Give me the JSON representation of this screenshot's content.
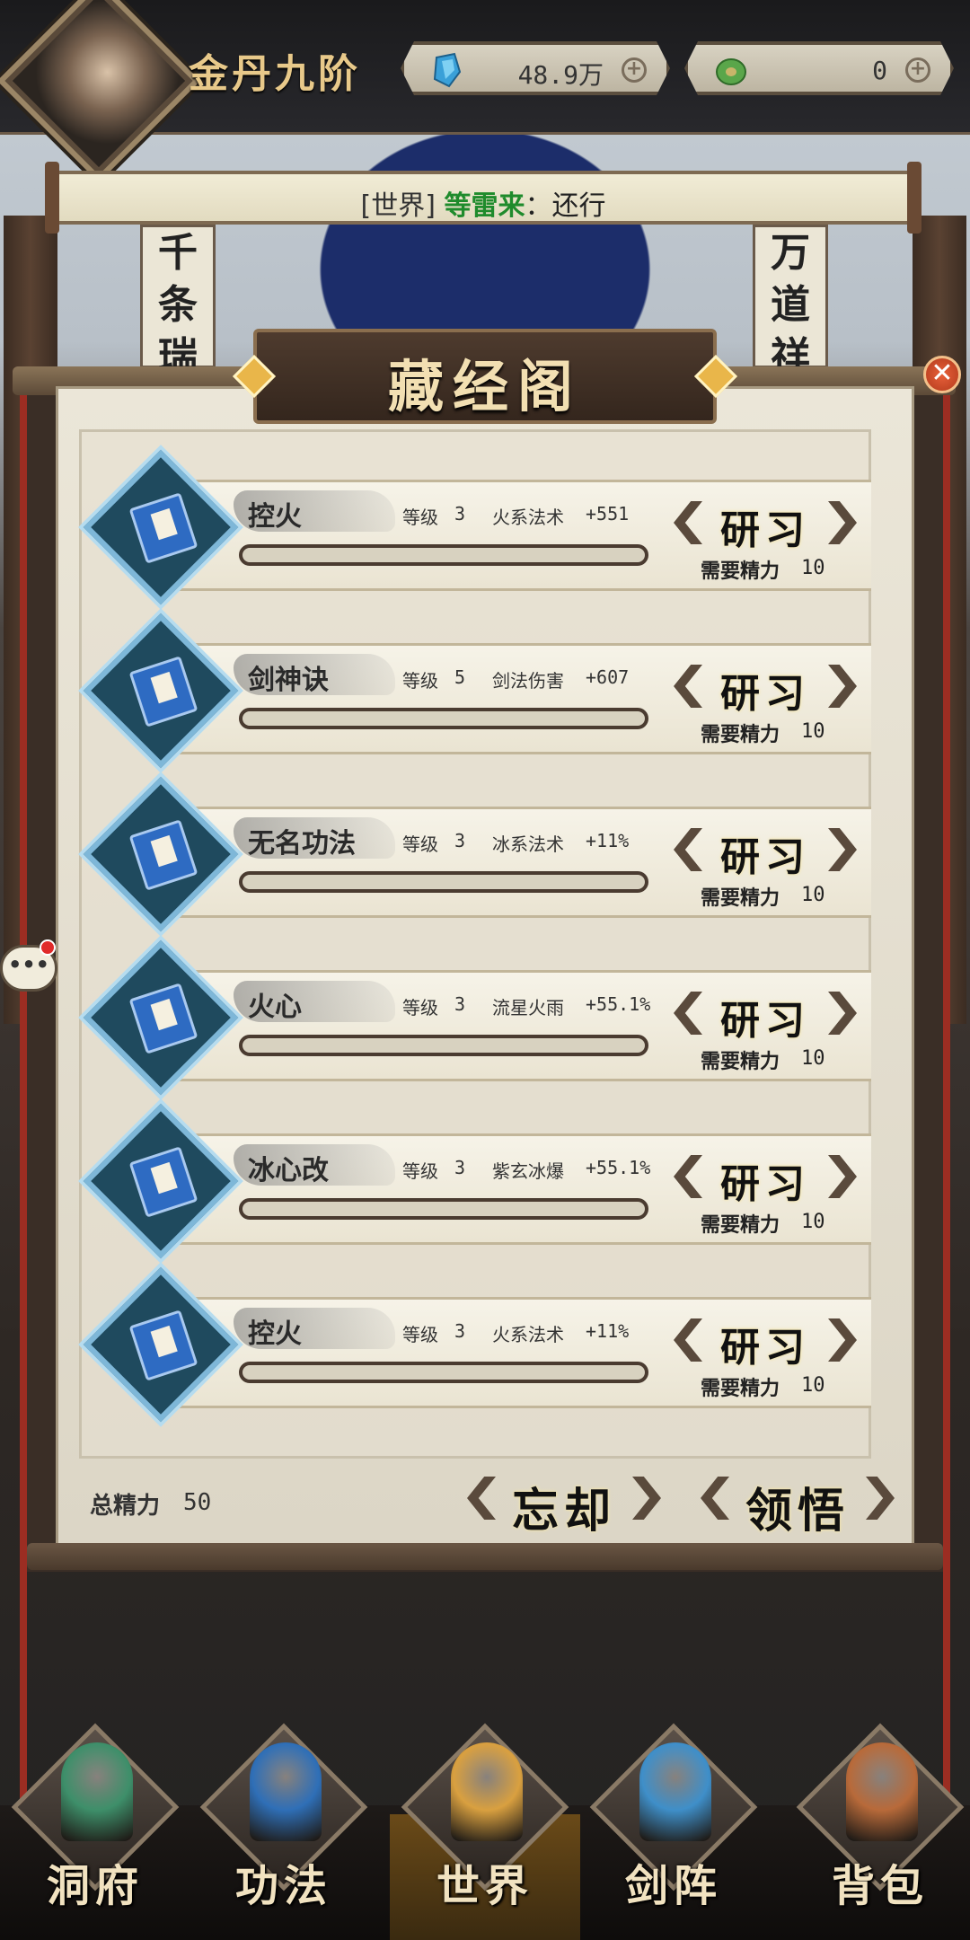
{
  "header": {
    "rank_title": "金丹九阶",
    "spirit_stones": "48.9万",
    "jade": "0"
  },
  "world_chat": {
    "tag": "[世界]",
    "sender": "等雷来",
    "message": "还行"
  },
  "background": {
    "left_scroll": "千条瑞",
    "right_scroll": "万道祥"
  },
  "panel": {
    "title": "藏经阁",
    "close_glyph": "✕",
    "level_label": "等级",
    "cost_label": "需要精力",
    "study_label": "研习",
    "skills": [
      {
        "name": "控火",
        "level": "3",
        "effect": "火系法术",
        "bonus": "+551",
        "cost": "10",
        "progress": 0.0
      },
      {
        "name": "剑神诀",
        "level": "5",
        "effect": "剑法伤害",
        "bonus": "+607",
        "cost": "10",
        "progress": 0.0
      },
      {
        "name": "无名功法",
        "level": "3",
        "effect": "冰系法术",
        "bonus": "+11%",
        "cost": "10",
        "progress": 0.0
      },
      {
        "name": "火心",
        "level": "3",
        "effect": "流星火雨",
        "bonus": "+55.1%",
        "cost": "10",
        "progress": 0.0
      },
      {
        "name": "冰心改",
        "level": "3",
        "effect": "紫玄冰爆",
        "bonus": "+55.1%",
        "cost": "10",
        "progress": 0.0
      },
      {
        "name": "控火",
        "level": "3",
        "effect": "火系法术",
        "bonus": "+11%",
        "cost": "10",
        "progress": 0.0
      }
    ],
    "total_label": "总精力",
    "total_value": "50",
    "forget_label": "忘却",
    "comprehend_label": "领悟"
  },
  "nav": [
    {
      "label": "洞府",
      "icon": "cave-dwelling-icon",
      "color": "#3e8f6a"
    },
    {
      "label": "功法",
      "icon": "manual-book-icon",
      "color": "#2f6fb7"
    },
    {
      "label": "世界",
      "icon": "world-scroll-icon",
      "color": "#d9a040"
    },
    {
      "label": "剑阵",
      "icon": "sword-array-icon",
      "color": "#3f8fc9"
    },
    {
      "label": "背包",
      "icon": "bag-icon",
      "color": "#b86a3a"
    }
  ],
  "chat_glyph": "•••"
}
